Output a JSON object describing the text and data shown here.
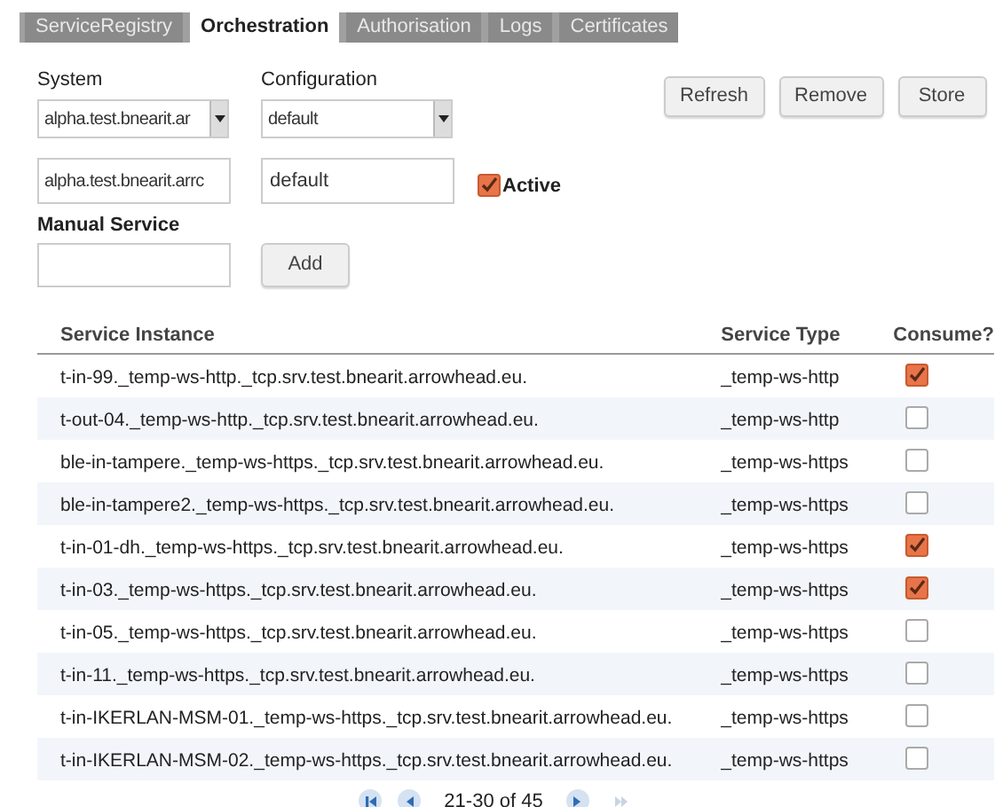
{
  "tabs": [
    {
      "label": "ServiceRegistry",
      "selected": false
    },
    {
      "label": "Orchestration",
      "selected": true
    },
    {
      "label": "Authorisation",
      "selected": false
    },
    {
      "label": "Logs",
      "selected": false
    },
    {
      "label": "Certificates",
      "selected": false
    }
  ],
  "system": {
    "label": "System",
    "select_value": "alpha.test.bnearit.ar",
    "input_value": "alpha.test.bnearit.arrc"
  },
  "configuration": {
    "label": "Configuration",
    "select_value": "default",
    "input_value": "default"
  },
  "active": {
    "label": "Active",
    "checked": true
  },
  "manual_service": {
    "label": "Manual Service",
    "add_button": "Add"
  },
  "buttons": [
    "Refresh",
    "Remove",
    "Store"
  ],
  "table": {
    "columns": [
      "Service Instance",
      "Service Type",
      "Consume?"
    ],
    "rows": [
      {
        "instance": "t-in-99._temp-ws-http._tcp.srv.test.bnearit.arrowhead.eu.",
        "type": "_temp-ws-http",
        "consume": true
      },
      {
        "instance": "t-out-04._temp-ws-http._tcp.srv.test.bnearit.arrowhead.eu.",
        "type": "_temp-ws-http",
        "consume": false
      },
      {
        "instance": "ble-in-tampere._temp-ws-https._tcp.srv.test.bnearit.arrowhead.eu.",
        "type": "_temp-ws-https",
        "consume": false
      },
      {
        "instance": "ble-in-tampere2._temp-ws-https._tcp.srv.test.bnearit.arrowhead.eu.",
        "type": "_temp-ws-https",
        "consume": false
      },
      {
        "instance": "t-in-01-dh._temp-ws-https._tcp.srv.test.bnearit.arrowhead.eu.",
        "type": "_temp-ws-https",
        "consume": true
      },
      {
        "instance": "t-in-03._temp-ws-https._tcp.srv.test.bnearit.arrowhead.eu.",
        "type": "_temp-ws-https",
        "consume": true
      },
      {
        "instance": "t-in-05._temp-ws-https._tcp.srv.test.bnearit.arrowhead.eu.",
        "type": "_temp-ws-https",
        "consume": false
      },
      {
        "instance": "t-in-11._temp-ws-https._tcp.srv.test.bnearit.arrowhead.eu.",
        "type": "_temp-ws-https",
        "consume": false
      },
      {
        "instance": "t-in-IKERLAN-MSM-01._temp-ws-https._tcp.srv.test.bnearit.arrowhead.eu.",
        "type": "_temp-ws-https",
        "consume": false
      },
      {
        "instance": "t-in-IKERLAN-MSM-02._temp-ws-https._tcp.srv.test.bnearit.arrowhead.eu.",
        "type": "_temp-ws-https",
        "consume": false
      }
    ]
  },
  "pager": {
    "text": "21-30 of 45",
    "first_disabled": false,
    "prev_disabled": false,
    "next_disabled": false,
    "last_disabled": true
  }
}
